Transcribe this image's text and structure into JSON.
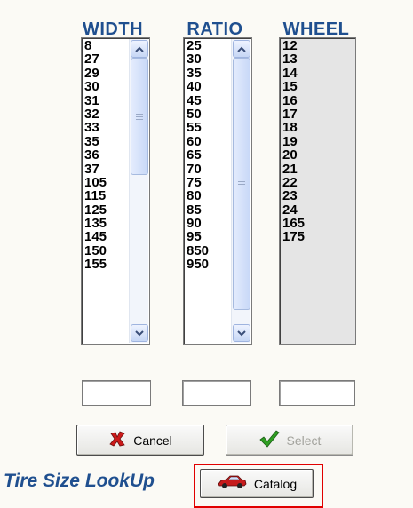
{
  "columns": {
    "width": {
      "header": "WIDTH",
      "items": [
        "8",
        "27",
        "29",
        "30",
        "31",
        "32",
        "33",
        "35",
        "36",
        "37",
        "105",
        "115",
        "125",
        "135",
        "145",
        "150",
        "155"
      ]
    },
    "ratio": {
      "header": "RATIO",
      "items": [
        "25",
        "30",
        "35",
        "40",
        "45",
        "50",
        "55",
        "60",
        "65",
        "70",
        "75",
        "80",
        "85",
        "90",
        "95",
        "850",
        "950"
      ]
    },
    "wheel": {
      "header": "WHEEL",
      "items": [
        "12",
        "13",
        "14",
        "15",
        "16",
        "17",
        "18",
        "19",
        "20",
        "21",
        "22",
        "23",
        "24",
        "165",
        "175"
      ]
    }
  },
  "inputs": {
    "width_value": "",
    "ratio_value": "",
    "wheel_value": ""
  },
  "buttons": {
    "cancel_label": "Cancel",
    "select_label": "Select",
    "catalog_label": "Catalog"
  },
  "footer": {
    "title": "Tire Size LookUp"
  },
  "icons": {
    "cancel": "red-x-icon",
    "select": "green-checkmark-icon",
    "catalog": "red-car-icon",
    "scroll_up": "chevron-up-icon",
    "scroll_down": "chevron-down-icon"
  },
  "colors": {
    "header_blue": "#1f4f8f",
    "highlight_red": "#e10000",
    "cancel_red": "#cc1a1a",
    "select_green": "#2e9e22"
  }
}
